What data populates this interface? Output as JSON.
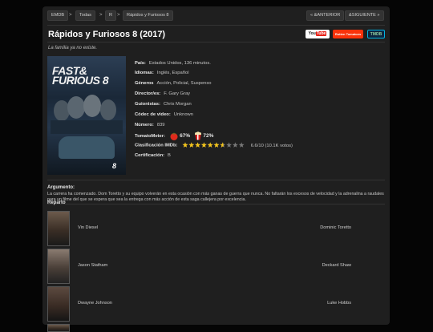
{
  "nav": {
    "breadcrumbs": [
      "EMDB",
      "Todas",
      "R",
      "Rápidos y Furiosos 8"
    ],
    "prev_label": "« &ANTERIOR",
    "next_label": "&SIGUIENTE »"
  },
  "movie": {
    "title": "Rápidos y Furiosos 8 (2017)",
    "tagline": "La familia ya no existe."
  },
  "logos": {
    "youtube": "YouTube",
    "rotten": "Rotten Tomatoes",
    "tmdb": "TMDB"
  },
  "poster": {
    "line1": "FAST&",
    "line2": "FURIOUS 8",
    "number": "8"
  },
  "details": [
    {
      "label": "País:",
      "value": "Estados Unidos, 136 minutos."
    },
    {
      "label": "Idiomas:",
      "value": "Inglés, Español"
    },
    {
      "label": "Géneros",
      "value": "Acción, Policial, Suspenso"
    },
    {
      "label": "Director/es:",
      "value": "F. Gary Gray"
    },
    {
      "label": "Guionistas:",
      "value": "Chris Morgan"
    },
    {
      "label": "Códec de video:",
      "value": "Unknown"
    },
    {
      "label": "Número:",
      "value": "839"
    }
  ],
  "tomatometer": {
    "label": "TomatoMeter:",
    "critics": "67%",
    "audience": "72%"
  },
  "imdb": {
    "label": "Clasificación IMDb:",
    "value": "6.6/10 (10.1K votos)",
    "stars_filled": 6.6,
    "stars_total": 10
  },
  "certification": {
    "label": "Certificación:",
    "value": "B"
  },
  "plot": {
    "heading": "Argumento:",
    "text": "La carrera ha comenzado. Dom Toretto y su equipo volverán en esta ocasión con más ganas de guerra que nunca. No faltarán los excesos de velocidad y la adrenalina a raudales para un filme del que se espera que sea la entrega con más acción de esta saga callejera por excelencia."
  },
  "cast": {
    "heading": "Reparto",
    "rows": [
      {
        "actor": "Vin Diesel",
        "role": "Dominic Toretto"
      },
      {
        "actor": "Jason Statham",
        "role": "Deckard Shaw"
      },
      {
        "actor": "Dwayne Johnson",
        "role": "Luke Hobbs"
      }
    ]
  },
  "colors": {
    "youtube_red": "#e62117",
    "rotten_red": "#fa320a",
    "tmdb_blue": "#0d253f",
    "star_gold": "#f5c518"
  }
}
